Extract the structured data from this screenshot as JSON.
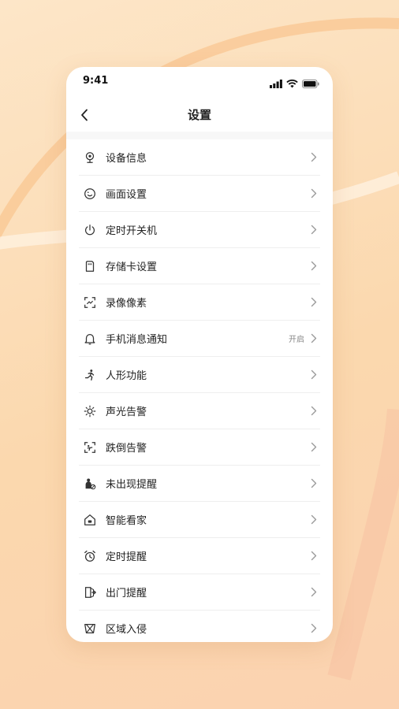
{
  "status_bar": {
    "time": "9:41"
  },
  "header": {
    "title": "设置"
  },
  "settings": [
    {
      "label": "设备信息",
      "icon": "camera-icon"
    },
    {
      "label": "画面设置",
      "icon": "smile-icon"
    },
    {
      "label": "定时开关机",
      "icon": "power-icon"
    },
    {
      "label": "存储卡设置",
      "icon": "sd-card-icon"
    },
    {
      "label": "录像像素",
      "icon": "scan-icon"
    },
    {
      "label": "手机消息通知",
      "icon": "bell-icon",
      "value": "开启"
    },
    {
      "label": "人形功能",
      "icon": "running-person-icon"
    },
    {
      "label": "声光告警",
      "icon": "sun-alarm-icon"
    },
    {
      "label": "跌倒告警",
      "icon": "fall-detect-icon"
    },
    {
      "label": "未出现提醒",
      "icon": "absent-person-icon"
    },
    {
      "label": "智能看家",
      "icon": "home-icon"
    },
    {
      "label": "定时提醒",
      "icon": "alarm-clock-icon"
    },
    {
      "label": "出门提醒",
      "icon": "exit-door-icon"
    },
    {
      "label": "区域入侵",
      "icon": "area-intrusion-icon"
    }
  ]
}
